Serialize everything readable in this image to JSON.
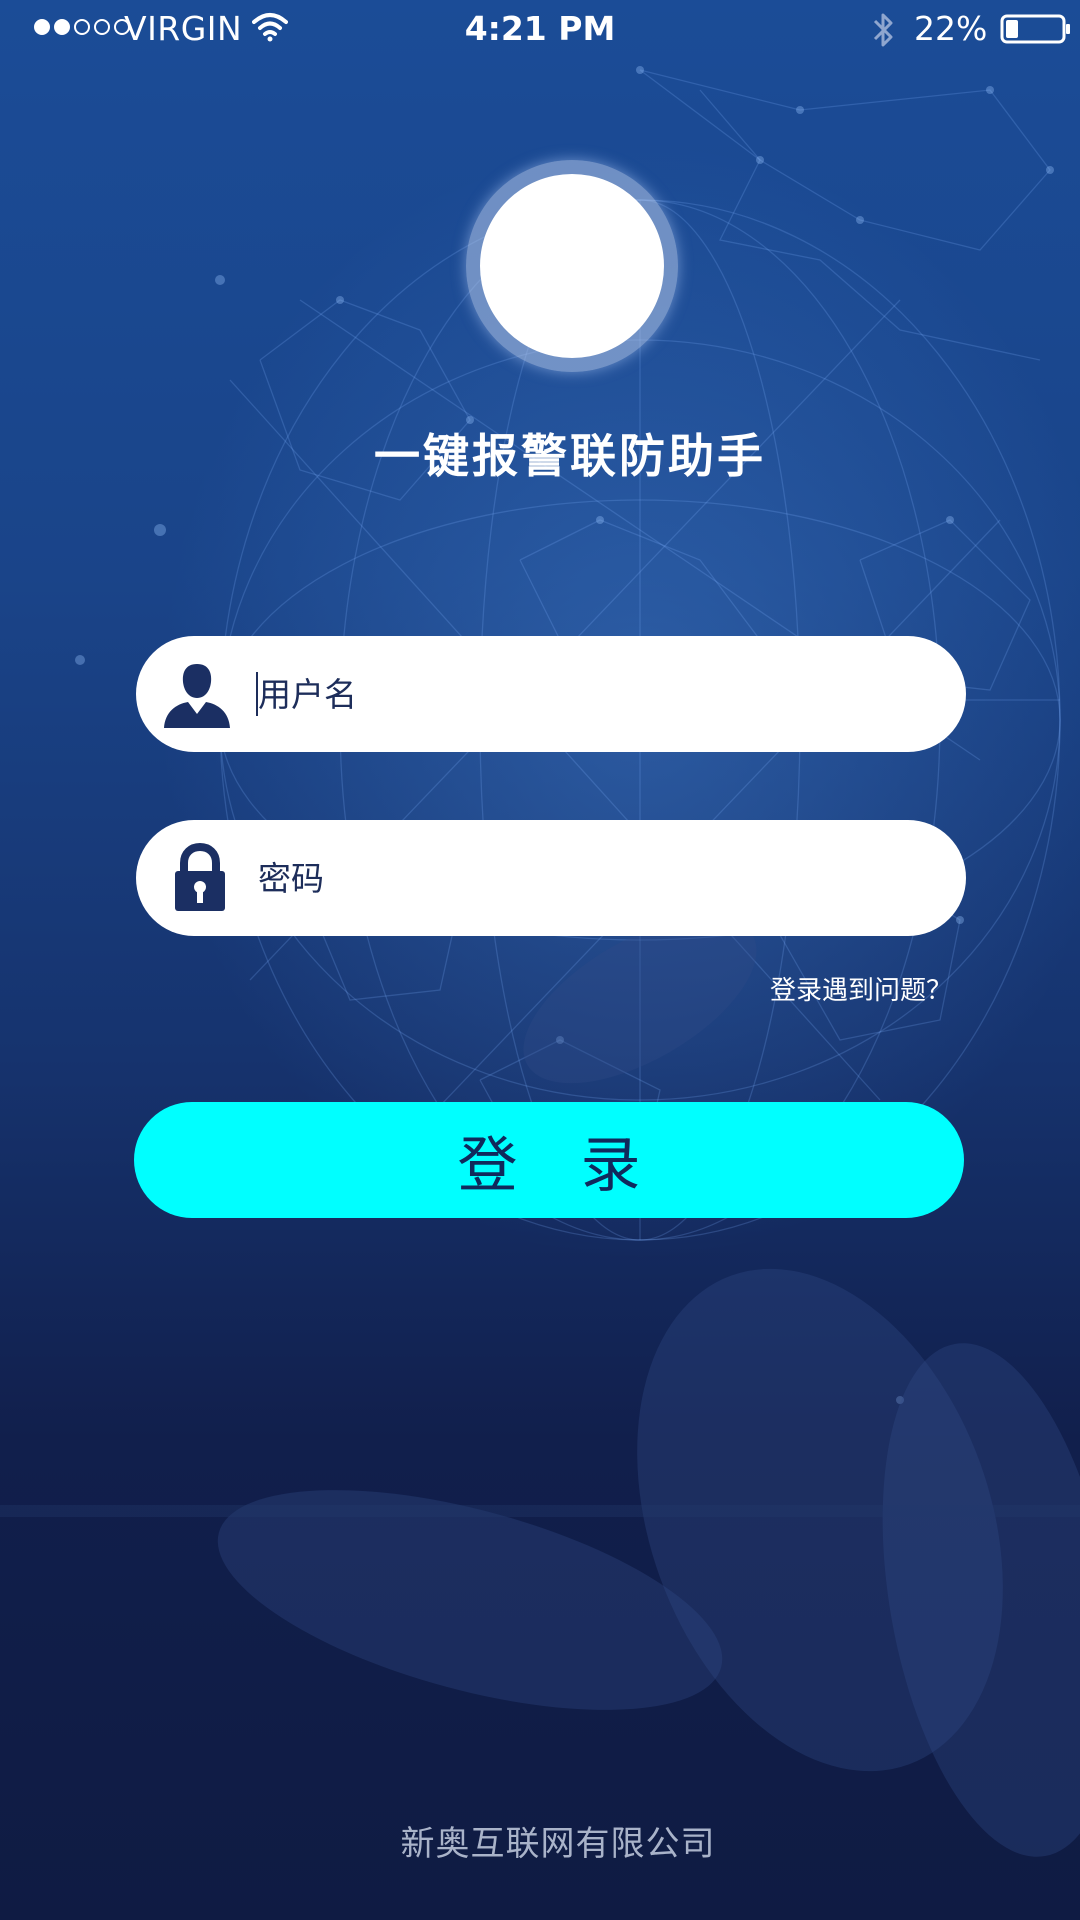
{
  "status_bar": {
    "carrier": "VIRGIN",
    "time": "4:21 PM",
    "battery_percent": "22%",
    "signal_strength": 2,
    "signal_total": 5,
    "battery_level": 0.22,
    "icons": [
      "signal-dots-icon",
      "wifi-icon",
      "bluetooth-icon",
      "battery-icon"
    ]
  },
  "app": {
    "title": "一键报警联防助手",
    "logo_icon": "app-logo-circle"
  },
  "login_form": {
    "username_placeholder": "用户名",
    "username_icon": "user-icon",
    "password_placeholder": "密码",
    "password_icon": "lock-icon",
    "help_link": "登录遇到问题？",
    "login_button": "登 录"
  },
  "footer": {
    "company": "新奥互联网有限公司"
  },
  "colors": {
    "background_top": "#1b4c97",
    "background_bottom": "#0f1b43",
    "accent": "#00ffff",
    "field_bg": "#ffffff",
    "text_dark": "#1d2d5a",
    "footer_text": "#a9b3c9"
  }
}
